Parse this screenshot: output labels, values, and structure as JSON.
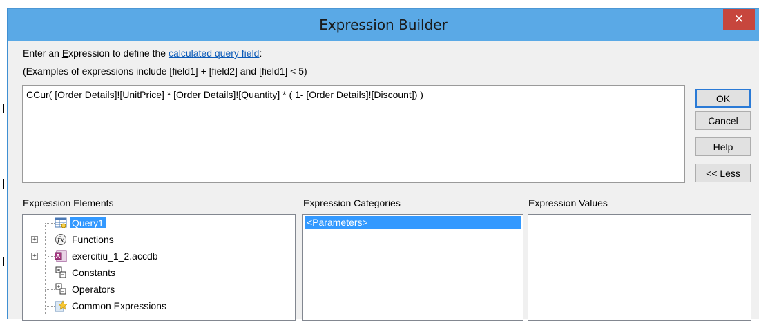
{
  "window": {
    "title": "Expression Builder",
    "close_label": "✕"
  },
  "prompt": {
    "line1_prefix": "Enter an ",
    "line1_accel": "E",
    "line1_mid": "xpression to define the ",
    "line1_link": "calculated query field",
    "line1_suffix": ":",
    "line2": "(Examples of expressions include [field1] + [field2] and [field1] < 5)"
  },
  "expression": {
    "value": "CCur( [Order Details]![UnitPrice] * [Order Details]![Quantity] * ( 1- [Order Details]![Discount]) )"
  },
  "buttons": {
    "ok": "OK",
    "cancel": "Cancel",
    "help": "Help",
    "less": "<< Less"
  },
  "elements": {
    "label": "Expression Elements",
    "items": [
      {
        "label": "Query1",
        "icon": "query-icon",
        "selected": true,
        "expandable": false
      },
      {
        "label": "Functions",
        "icon": "functions-icon",
        "selected": false,
        "expandable": true
      },
      {
        "label": "exercitiu_1_2.accdb",
        "icon": "database-icon",
        "selected": false,
        "expandable": true
      },
      {
        "label": "Constants",
        "icon": "constants-icon",
        "selected": false,
        "expandable": false
      },
      {
        "label": "Operators",
        "icon": "operators-icon",
        "selected": false,
        "expandable": false
      },
      {
        "label": "Common Expressions",
        "icon": "common-expressions-icon",
        "selected": false,
        "expandable": false
      }
    ]
  },
  "categories": {
    "label": "Expression Categories",
    "items": [
      "<Parameters>"
    ]
  },
  "values": {
    "label": "Expression Values",
    "items": []
  },
  "colors": {
    "titlebar": "#5aa9e6",
    "close": "#c7463d",
    "selection": "#3399ff",
    "link": "#0b5ab8"
  }
}
